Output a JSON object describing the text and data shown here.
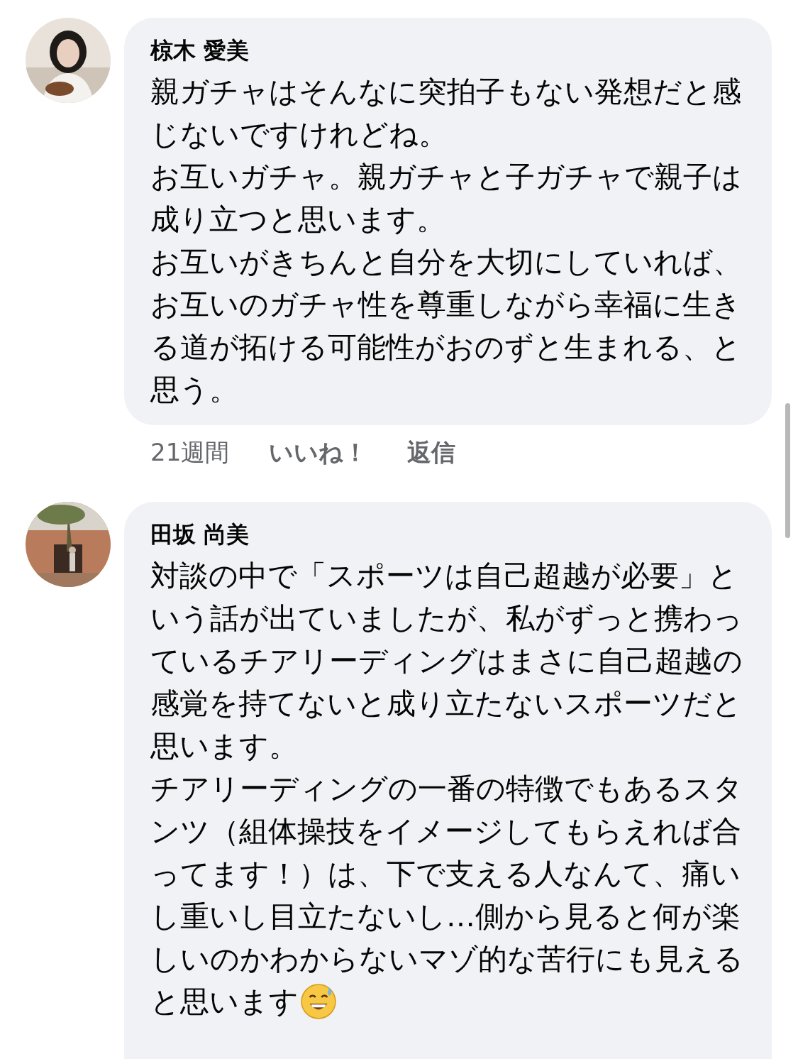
{
  "comments": [
    {
      "author": "椋木 愛美",
      "avatar": {
        "kind": "picture"
      },
      "paragraphs": [
        "親ガチャはそんなに突拍子もない発想だと感じないですけれどね。",
        "お互いガチャ。親ガチャと子ガチャで親子は成り立つと思います。",
        "お互いがきちんと自分を大切にしていれば、お互いのガチャ性を尊重しながら幸福に生きる道が拓ける可能性がおのずと生まれる、と思う。"
      ],
      "ends_with_emoji": false,
      "meta": {
        "time": "21週間",
        "like": "いいね！",
        "reply": "返信"
      }
    },
    {
      "author": "田坂 尚美",
      "avatar": {
        "kind": "picture"
      },
      "paragraphs": [
        "対談の中で「スポーツは自己超越が必要」という話が出ていましたが、私がずっと携わっているチアリーディングはまさに自己超越の感覚を持てないと成り立たないスポーツだと思います。",
        "チアリーディングの一番の特徴でもあるスタンツ（組体操技をイメージしてもらえれば合ってます！）は、下で支える人なんて、痛いし重いし目立たないし…側から見ると何が楽しいのかわからないマゾ的な苦行にも見えると思います"
      ],
      "ends_with_emoji": true
    }
  ]
}
